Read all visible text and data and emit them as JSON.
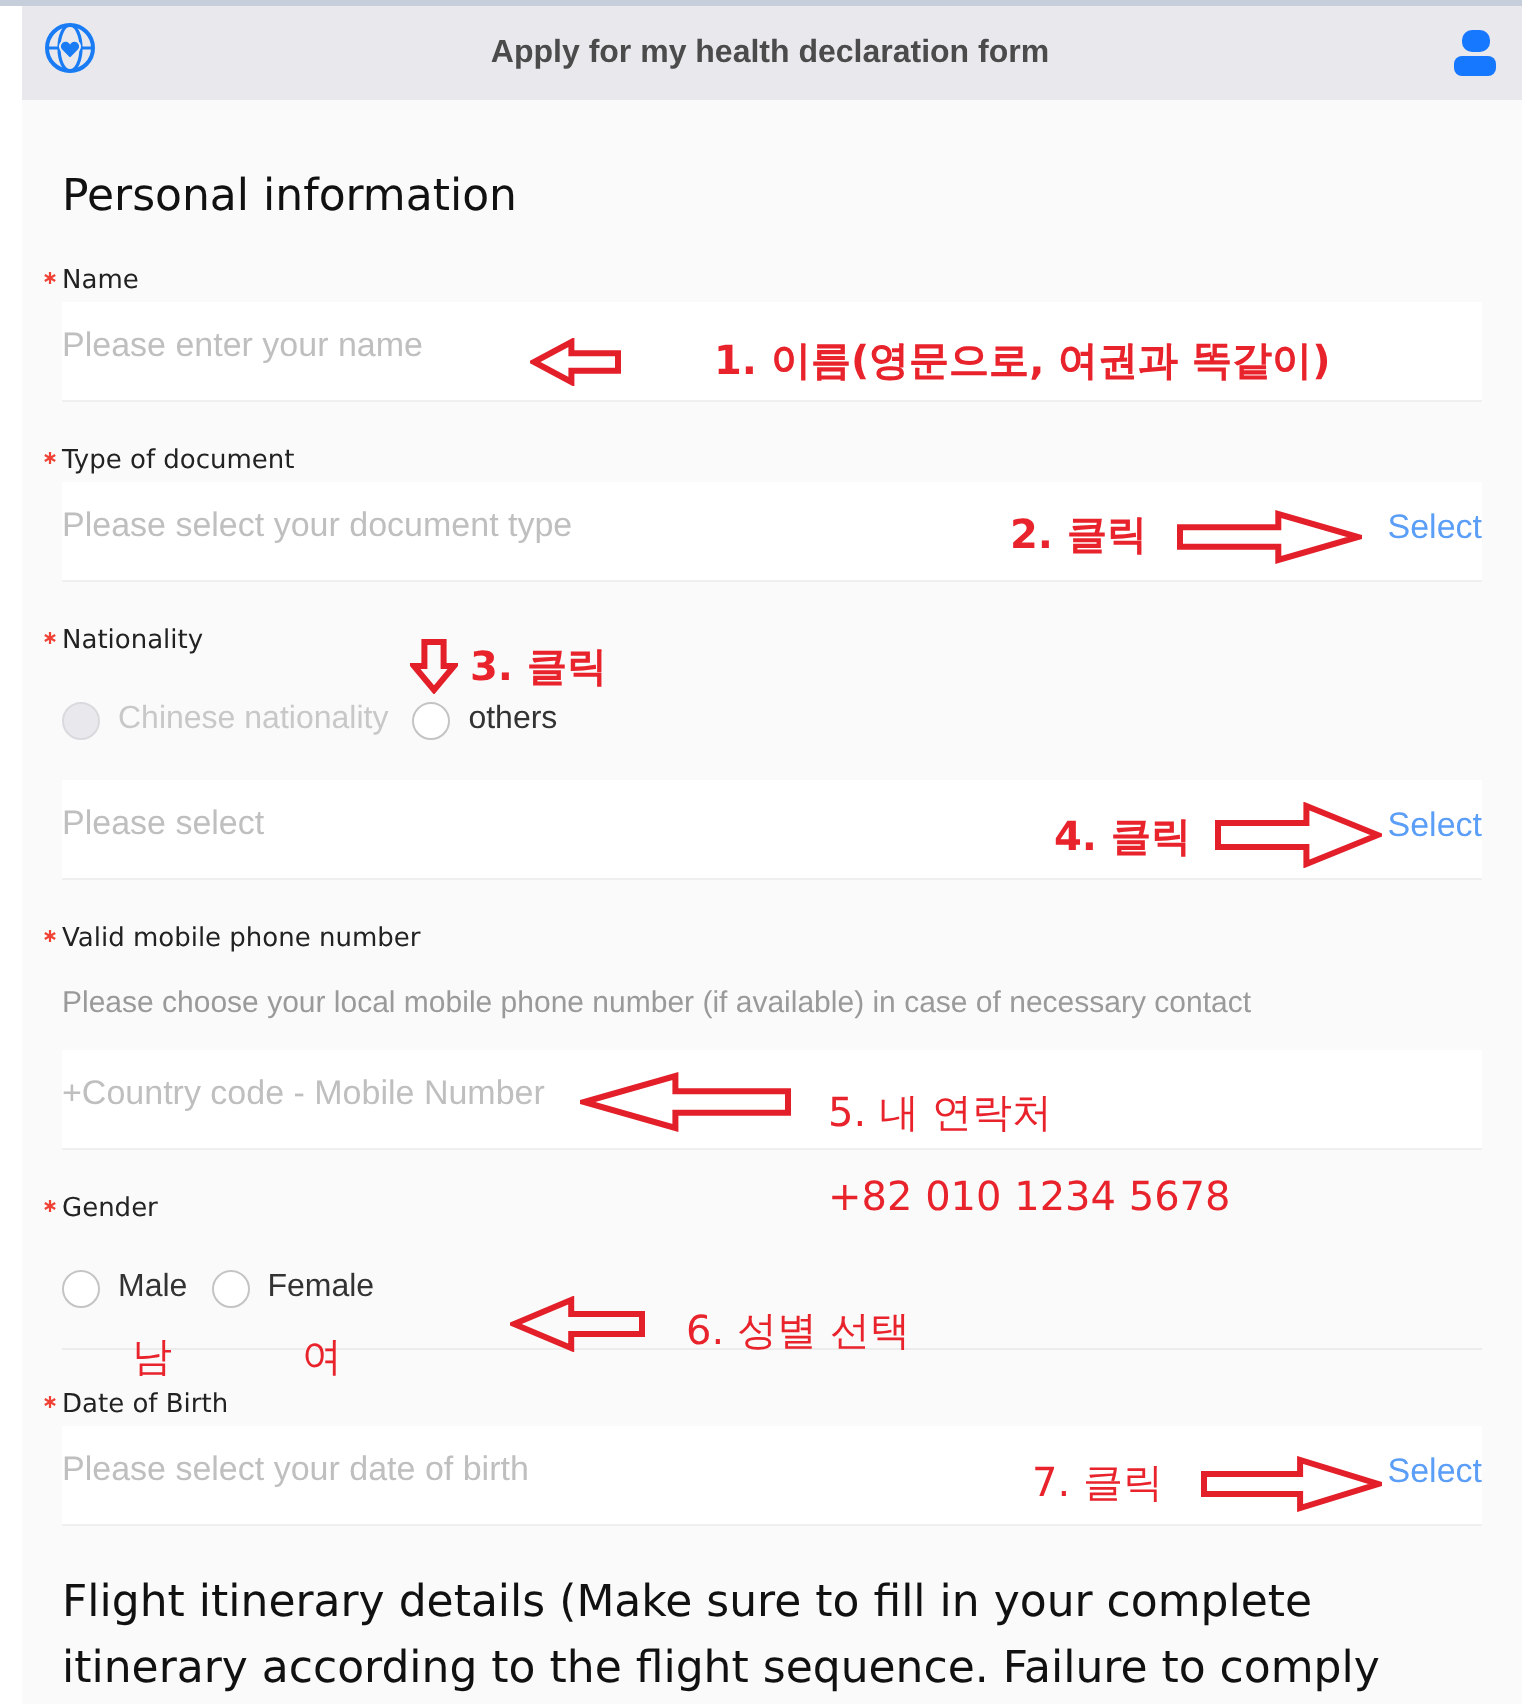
{
  "header": {
    "title": "Apply for my health declaration form"
  },
  "section_title": "Personal information",
  "fields": [
    {
      "kind": "input",
      "label": "Name",
      "required": true,
      "placeholder": "Please enter your name"
    },
    {
      "kind": "select",
      "label": "Type of document",
      "required": true,
      "placeholder": "Please select your document type",
      "action": "Select"
    },
    {
      "kind": "radio",
      "label": "Nationality",
      "required": true,
      "options": [
        {
          "label": "Chinese nationality",
          "selected": false,
          "disabled": true
        },
        {
          "label": "others",
          "selected": false,
          "disabled": false
        }
      ],
      "placeholder": "Please select",
      "action": "Select"
    },
    {
      "kind": "input",
      "label": "Valid mobile phone number",
      "required": true,
      "hint": "Please choose your local mobile phone number (if available) in case of necessary contact",
      "placeholder": "+Country code - Mobile Number"
    },
    {
      "kind": "radio",
      "label": "Gender",
      "required": true,
      "options": [
        {
          "label": "Male",
          "selected": false,
          "disabled": false
        },
        {
          "label": "Female",
          "selected": false,
          "disabled": false
        }
      ]
    },
    {
      "kind": "select",
      "label": "Date of Birth",
      "required": true,
      "placeholder": "Please select your date of birth",
      "action": "Select"
    }
  ],
  "next_section_title": "Flight itinerary details (Make sure to fill in your complete itinerary according to the flight sequence. Failure to comply",
  "annotations": [
    "1. 이름(영문으로, 여권과 똑같이)",
    "2. 클릭",
    "3. 클릭",
    "4. 클릭",
    "5. 내 연락처",
    "+82 010 1234 5678",
    "6. 성별 선택",
    "남",
    "여",
    "7. 클릭"
  ]
}
